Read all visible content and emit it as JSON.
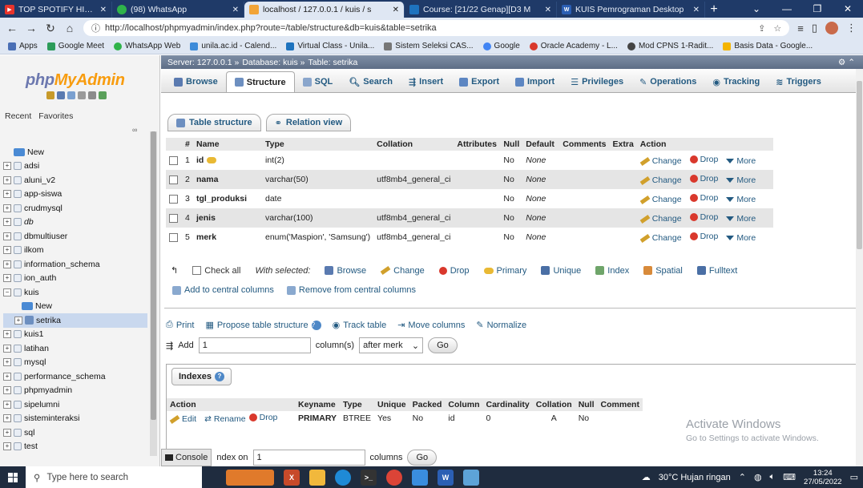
{
  "browser": {
    "tabs": [
      {
        "label": "TOP SPOTIFY HITS INDO",
        "color": "#e8332b",
        "active": false
      },
      {
        "label": "(98) WhatsApp",
        "color": "#2fb34a",
        "active": false
      },
      {
        "label": "localhost / 127.0.0.1 / kuis / s",
        "color": "#f2a437",
        "active": true
      },
      {
        "label": "Course: [21/22 Genap][D3 M",
        "color": "#1e73be",
        "active": false
      },
      {
        "label": "KUIS Pemrograman Desktop",
        "color": "#2b5fb4",
        "active": false
      }
    ],
    "url": "http://localhost/phpmyadmin/index.php?route=/table/structure&db=kuis&table=setrika",
    "bookmarks": [
      {
        "label": "Apps",
        "color": "#4a6fb5"
      },
      {
        "label": "Google Meet",
        "color": "#2c9c5a"
      },
      {
        "label": "WhatsApp Web",
        "color": "#2fb34a"
      },
      {
        "label": "unila.ac.id - Calend...",
        "color": "#3d8bd9"
      },
      {
        "label": "Virtual Class - Unila...",
        "color": "#1e73be"
      },
      {
        "label": "Sistem Seleksi CAS...",
        "color": "#777777"
      },
      {
        "label": "Google",
        "color": "#4285f4"
      },
      {
        "label": "Oracle Academy - L...",
        "color": "#d9382c"
      },
      {
        "label": "Mod CPNS 1-Radit...",
        "color": "#444444"
      },
      {
        "label": "Basis Data - Google...",
        "color": "#f4b400"
      }
    ]
  },
  "sidebar": {
    "logo_php": "php",
    "logo_myadmin": "MyAdmin",
    "recent": "Recent",
    "favorites": "Favorites",
    "databases": [
      {
        "label": "New",
        "level": 0,
        "type": "new"
      },
      {
        "label": "adsi",
        "level": 0,
        "type": "db"
      },
      {
        "label": "aluni_v2",
        "level": 0,
        "type": "db"
      },
      {
        "label": "app-siswa",
        "level": 0,
        "type": "db"
      },
      {
        "label": "crudmysql",
        "level": 0,
        "type": "db"
      },
      {
        "label": "db",
        "level": 0,
        "type": "db"
      },
      {
        "label": "dbmultiuser",
        "level": 0,
        "type": "db"
      },
      {
        "label": "ilkom",
        "level": 0,
        "type": "db"
      },
      {
        "label": "information_schema",
        "level": 0,
        "type": "db"
      },
      {
        "label": "ion_auth",
        "level": 0,
        "type": "db"
      },
      {
        "label": "kuis",
        "level": 0,
        "type": "db-open"
      },
      {
        "label": "New",
        "level": 2,
        "type": "new"
      },
      {
        "label": "setrika",
        "level": 1,
        "type": "table"
      },
      {
        "label": "kuis1",
        "level": 0,
        "type": "db"
      },
      {
        "label": "latihan",
        "level": 0,
        "type": "db"
      },
      {
        "label": "mysql",
        "level": 0,
        "type": "db"
      },
      {
        "label": "performance_schema",
        "level": 0,
        "type": "db"
      },
      {
        "label": "phpmyadmin",
        "level": 0,
        "type": "db"
      },
      {
        "label": "sipelumni",
        "level": 0,
        "type": "db"
      },
      {
        "label": "sisteminteraksi",
        "level": 0,
        "type": "db"
      },
      {
        "label": "sql",
        "level": 0,
        "type": "db"
      },
      {
        "label": "test",
        "level": 0,
        "type": "db"
      }
    ]
  },
  "breadcrumb": {
    "server": "Server: 127.0.0.1 »",
    "database": "Database: kuis »",
    "table": "Table: setrika"
  },
  "menu": {
    "items": [
      "Browse",
      "Structure",
      "SQL",
      "Search",
      "Insert",
      "Export",
      "Import",
      "Privileges",
      "Operations",
      "Tracking",
      "Triggers"
    ]
  },
  "subtabs": [
    "Table structure",
    "Relation view"
  ],
  "structure": {
    "headers": [
      "#",
      "Name",
      "Type",
      "Collation",
      "Attributes",
      "Null",
      "Default",
      "Comments",
      "Extra",
      "Action"
    ],
    "rows": [
      {
        "num": "1",
        "name": "id",
        "type": "int(2)",
        "collation": "",
        "null": "No",
        "default": "None",
        "primary": true
      },
      {
        "num": "2",
        "name": "nama",
        "type": "varchar(50)",
        "collation": "utf8mb4_general_ci",
        "null": "No",
        "default": "None",
        "primary": false
      },
      {
        "num": "3",
        "name": "tgl_produksi",
        "type": "date",
        "collation": "",
        "null": "No",
        "default": "None",
        "primary": false
      },
      {
        "num": "4",
        "name": "jenis",
        "type": "varchar(100)",
        "collation": "utf8mb4_general_ci",
        "null": "No",
        "default": "None",
        "primary": false
      },
      {
        "num": "5",
        "name": "merk",
        "type": "enum('Maspion', 'Samsung')",
        "collation": "utf8mb4_general_ci",
        "null": "No",
        "default": "None",
        "primary": false
      }
    ],
    "action_change": "Change",
    "action_drop": "Drop",
    "action_more": "More"
  },
  "selection": {
    "check_all": "Check all",
    "with_selected": "With selected:",
    "actions": [
      "Browse",
      "Change",
      "Drop",
      "Primary",
      "Unique",
      "Index",
      "Spatial",
      "Fulltext"
    ],
    "add_central": "Add to central columns",
    "remove_central": "Remove from central columns"
  },
  "tools": [
    "Print",
    "Propose table structure",
    "Track table",
    "Move columns",
    "Normalize"
  ],
  "addcol": {
    "add_label": "Add",
    "count": "1",
    "columns_label": "column(s)",
    "position": "after merk",
    "go": "Go"
  },
  "indexes": {
    "title": "Indexes",
    "headers": [
      "Action",
      "Keyname",
      "Type",
      "Unique",
      "Packed",
      "Column",
      "Cardinality",
      "Collation",
      "Null",
      "Comment"
    ],
    "row": {
      "edit": "Edit",
      "rename": "Rename",
      "drop": "Drop",
      "keyname": "PRIMARY",
      "type": "BTREE",
      "unique": "Yes",
      "packed": "No",
      "column": "id",
      "cardinality": "0",
      "collation": "A",
      "null": "No",
      "comment": ""
    }
  },
  "watermark": {
    "line1": "Activate Windows",
    "line2": "Go to Settings to activate Windows."
  },
  "console": {
    "label": "Console",
    "index_on_label": "ndex on",
    "count": "1",
    "columns_label": "columns",
    "go": "Go"
  },
  "taskbar": {
    "search_placeholder": "Type here to search",
    "weather": "30°C  Hujan ringan",
    "time": "13:24",
    "date": "27/05/2022"
  }
}
